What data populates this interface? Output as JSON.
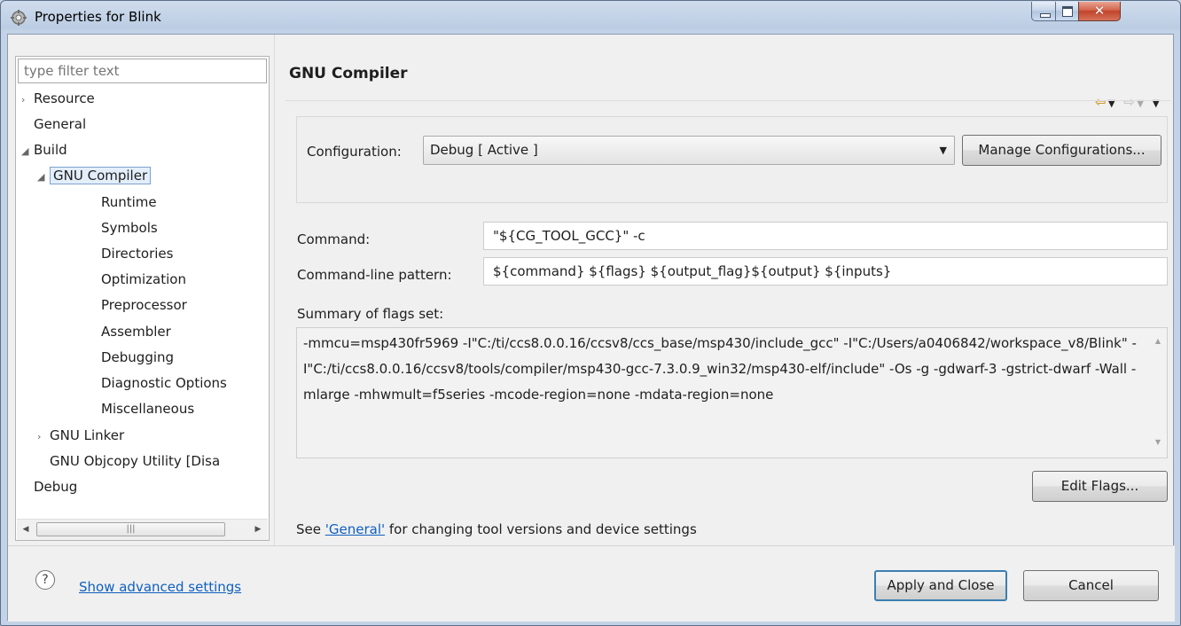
{
  "window": {
    "title": "Properties for Blink"
  },
  "filter": {
    "placeholder": "type filter text"
  },
  "tree": {
    "resource": "Resource",
    "general": "General",
    "build": "Build",
    "gnu_compiler": "GNU Compiler",
    "runtime": "Runtime",
    "symbols": "Symbols",
    "directories": "Directories",
    "optimization": "Optimization",
    "preprocessor": "Preprocessor",
    "assembler": "Assembler",
    "debugging": "Debugging",
    "diagnostic_options": "Diagnostic Options",
    "miscellaneous": "Miscellaneous",
    "gnu_linker": "GNU Linker",
    "gnu_objcopy": "GNU Objcopy Utility  [Disa",
    "debug": "Debug"
  },
  "page": {
    "title": "GNU Compiler"
  },
  "configuration": {
    "label": "Configuration:",
    "value": "Debug  [ Active ]",
    "manage_button": "Manage Configurations..."
  },
  "command": {
    "label": "Command:",
    "value": "\"${CG_TOOL_GCC}\" -c"
  },
  "pattern": {
    "label": "Command-line pattern:",
    "value": "${command} ${flags} ${output_flag}${output} ${inputs}"
  },
  "summary": {
    "label": "Summary of flags set:",
    "text": "-mmcu=msp430fr5969 -I\"C:/ti/ccs8.0.0.16/ccsv8/ccs_base/msp430/include_gcc\" -I\"C:/Users/a0406842/workspace_v8/Blink\" -I\"C:/ti/ccs8.0.0.16/ccsv8/tools/compiler/msp430-gcc-7.3.0.9_win32/msp430-elf/include\" -Os -g -gdwarf-3 -gstrict-dwarf -Wall -mlarge -mhwmult=f5series -mcode-region=none -mdata-region=none"
  },
  "edit_flags_button": "Edit Flags...",
  "footnote": {
    "prefix": "See ",
    "link": "'General'",
    "suffix": " for changing tool versions and device settings"
  },
  "bottom": {
    "advanced_link": "Show advanced settings",
    "apply_button": "Apply and Close",
    "cancel_button": "Cancel"
  },
  "colors": {
    "link": "#0f5fc0",
    "close_button": "#c2432b",
    "selection_border": "#7da2ce"
  }
}
